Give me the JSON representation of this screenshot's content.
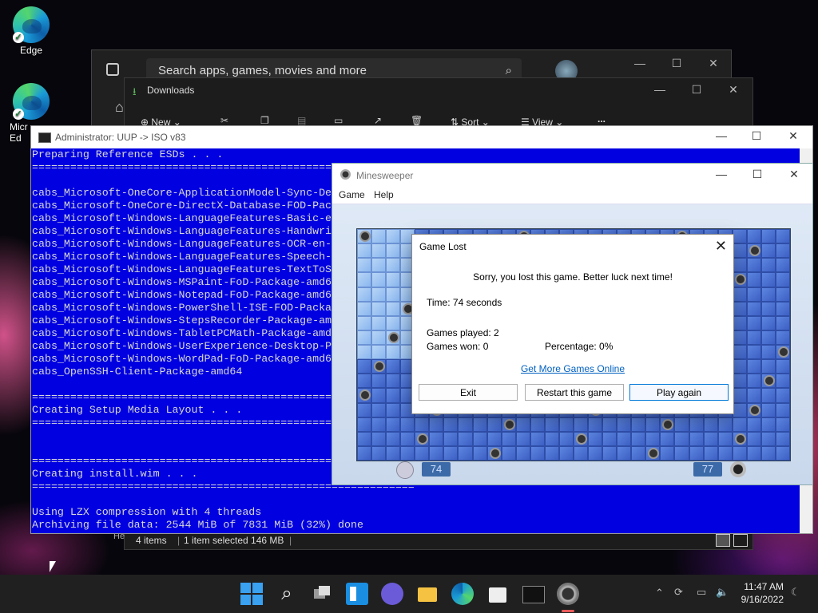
{
  "desktop": {
    "icons": [
      {
        "label": "Edge"
      },
      {
        "label": "Micr\nEd"
      }
    ]
  },
  "store": {
    "search_placeholder": "Search apps, games, movies and more"
  },
  "explorer": {
    "title": "Downloads",
    "toolbar": {
      "new": "New",
      "sort": "Sort",
      "view": "View",
      "more": "..."
    },
    "status": {
      "items": "4 items",
      "selected": "1 item selected  146 MB"
    },
    "hel": "Hel"
  },
  "cmd": {
    "title": "Administrator:  UUP -> ISO v83",
    "lines": [
      "Preparing Reference ESDs . . .",
      "============================================================",
      "",
      "cabs_Microsoft-OneCore-ApplicationModel-Sync-De",
      "cabs_Microsoft-OneCore-DirectX-Database-FOD-Pac",
      "cabs_Microsoft-Windows-LanguageFeatures-Basic-e",
      "cabs_Microsoft-Windows-LanguageFeatures-Handwri",
      "cabs_Microsoft-Windows-LanguageFeatures-OCR-en-",
      "cabs_Microsoft-Windows-LanguageFeatures-Speech-",
      "cabs_Microsoft-Windows-LanguageFeatures-TextToS",
      "cabs_Microsoft-Windows-MSPaint-FoD-Package-amd6",
      "cabs_Microsoft-Windows-Notepad-FoD-Package-amd6",
      "cabs_Microsoft-Windows-PowerShell-ISE-FOD-Packa",
      "cabs_Microsoft-Windows-StepsRecorder-Package-am",
      "cabs_Microsoft-Windows-TabletPCMath-Package-amd",
      "cabs_Microsoft-Windows-UserExperience-Desktop-P",
      "cabs_Microsoft-Windows-WordPad-FoD-Package-amd6",
      "cabs_OpenSSH-Client-Package-amd64",
      "",
      "============================================================",
      "Creating Setup Media Layout . . .",
      "============================================================",
      "",
      "",
      "============================================================",
      "Creating install.wim . . .",
      "============================================================",
      "",
      "Using LZX compression with 4 threads",
      "Archiving file data: 2544 MiB of 7831 MiB (32%) done"
    ]
  },
  "minesweeper": {
    "title": "Minesweeper",
    "menu": {
      "game": "Game",
      "help": "Help"
    },
    "time_counter": "74",
    "mines_counter": "77"
  },
  "dialog": {
    "title": "Game Lost",
    "message": "Sorry, you lost this game. Better luck next time!",
    "time": "Time: 74 seconds",
    "games_played": "Games played: 2",
    "games_won": "Games won: 0",
    "percentage": "Percentage: 0%",
    "link": "Get More Games Online",
    "buttons": {
      "exit": "Exit",
      "restart": "Restart this game",
      "play_again": "Play again"
    }
  },
  "taskbar": {
    "time": "11:47 AM",
    "date": "9/16/2022"
  },
  "colors": {
    "console_bg": "#0000e0",
    "accent": "#0078d7"
  }
}
